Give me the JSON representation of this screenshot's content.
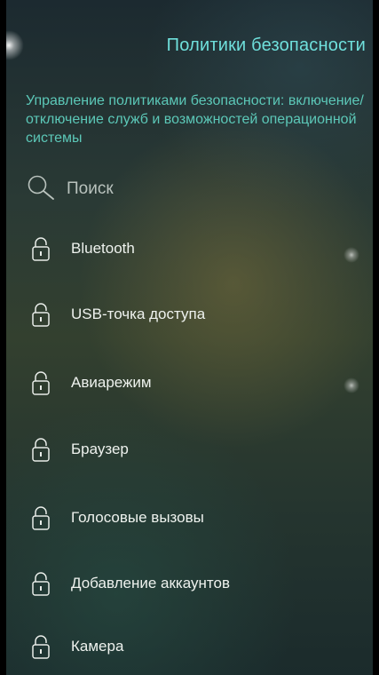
{
  "header": {
    "title": "Политики безопасности",
    "description": "Управление политиками безопасности: включение/отключение служб и возможностей операционной системы"
  },
  "search": {
    "icon": "search-icon",
    "label": "Поиск"
  },
  "policies": [
    {
      "label": "Bluetooth",
      "icon": "lock-icon"
    },
    {
      "label": "USB-точка доступа",
      "icon": "lock-icon"
    },
    {
      "label": "Авиарежим",
      "icon": "lock-icon"
    },
    {
      "label": "Браузер",
      "icon": "lock-icon"
    },
    {
      "label": "Голосовые вызовы",
      "icon": "lock-icon"
    },
    {
      "label": "Добавление аккаунтов",
      "icon": "lock-icon"
    },
    {
      "label": "Камера",
      "icon": "lock-icon"
    }
  ],
  "colors": {
    "title": "#6fe0dc",
    "description": "#5cc8b8",
    "item_text": "#eef2ee",
    "search_text": "#b9c2bd"
  }
}
